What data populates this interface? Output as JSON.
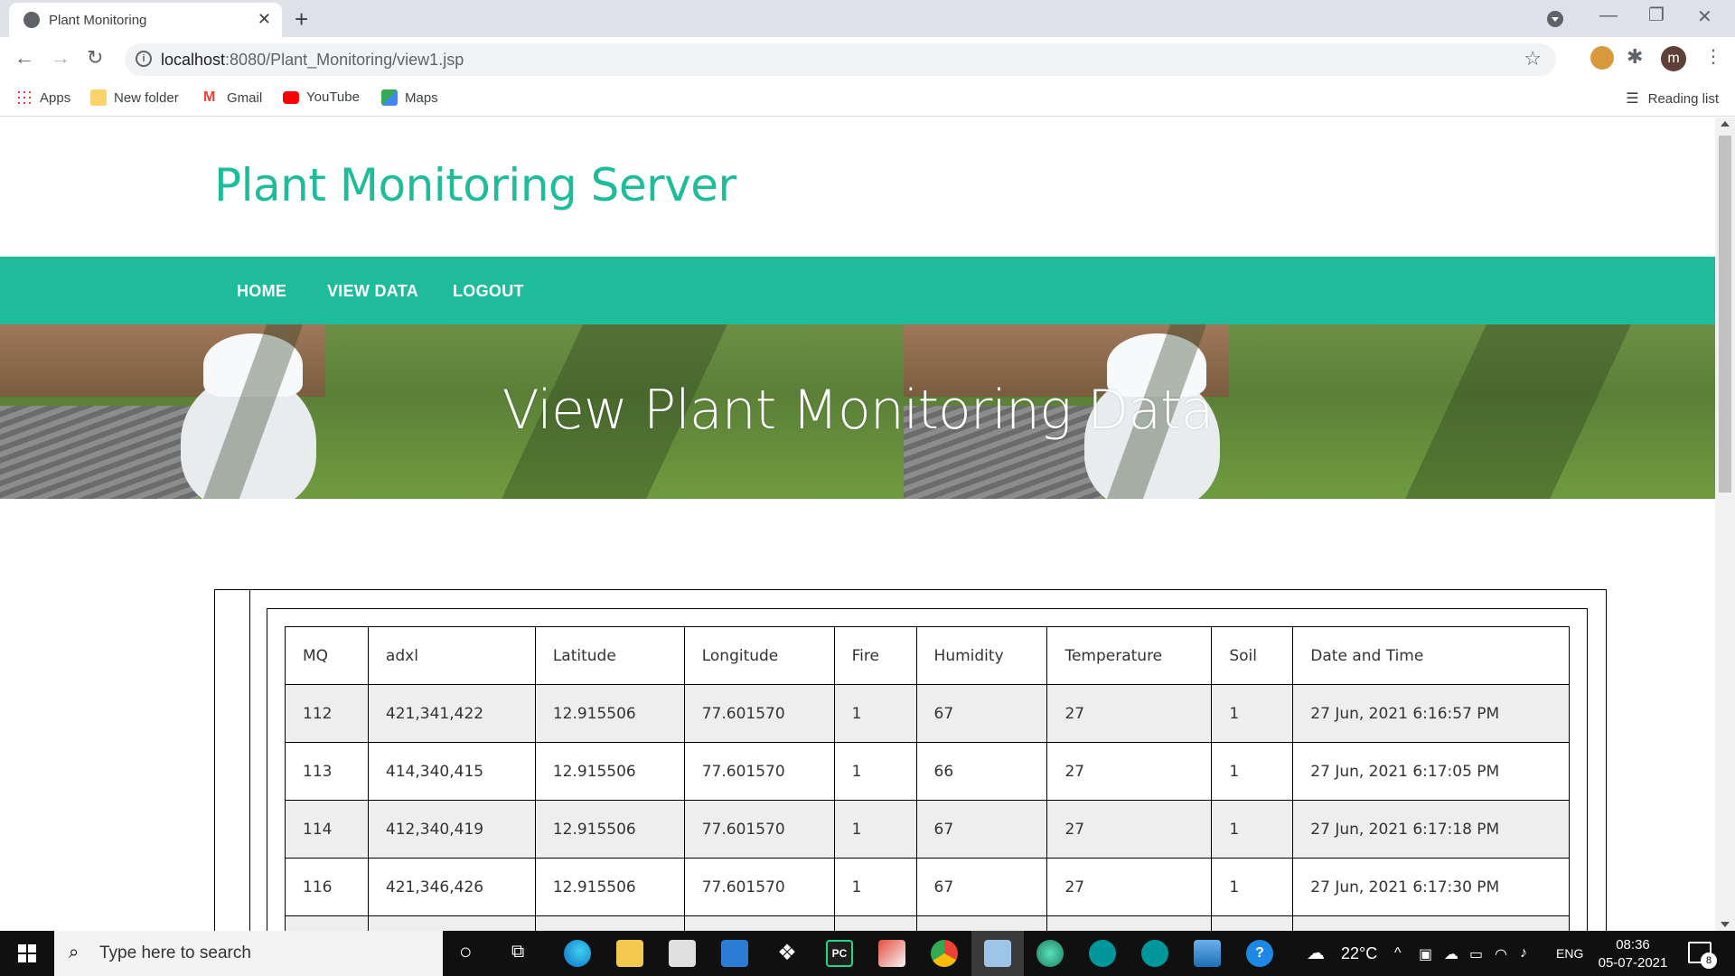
{
  "browser": {
    "tab_title": "Plant Monitoring",
    "url_host": "localhost",
    "url_path": ":8080/Plant_Monitoring/view1.jsp",
    "avatar_letter": "m",
    "bookmarks": [
      "Apps",
      "New folder",
      "Gmail",
      "YouTube",
      "Maps"
    ],
    "reading_list": "Reading list"
  },
  "site": {
    "title": "Plant Monitoring Server",
    "nav": [
      "HOME",
      "VIEW DATA",
      "LOGOUT"
    ],
    "banner_title": "View Plant Monitoring Data",
    "accent_color": "#1fbc9c"
  },
  "table": {
    "headers": [
      "MQ",
      "adxl",
      "Latitude",
      "Longitude",
      "Fire",
      "Humidity",
      "Temperature",
      "Soil",
      "Date and Time"
    ],
    "rows": [
      [
        "112",
        "421,341,422",
        "12.915506",
        "77.601570",
        "1",
        "67",
        "27",
        "1",
        "27 Jun, 2021 6:16:57 PM"
      ],
      [
        "113",
        "414,340,415",
        "12.915506",
        "77.601570",
        "1",
        "66",
        "27",
        "1",
        "27 Jun, 2021 6:17:05 PM"
      ],
      [
        "114",
        "412,340,419",
        "12.915506",
        "77.601570",
        "1",
        "67",
        "27",
        "1",
        "27 Jun, 2021 6:17:18 PM"
      ],
      [
        "116",
        "421,346,426",
        "12.915506",
        "77.601570",
        "1",
        "67",
        "27",
        "1",
        "27 Jun, 2021 6:17:30 PM"
      ]
    ]
  },
  "taskbar": {
    "search_placeholder": "Type here to search",
    "weather": "22°C",
    "language": "ENG",
    "time": "08:36",
    "date": "05-07-2021",
    "notification_count": "8"
  }
}
